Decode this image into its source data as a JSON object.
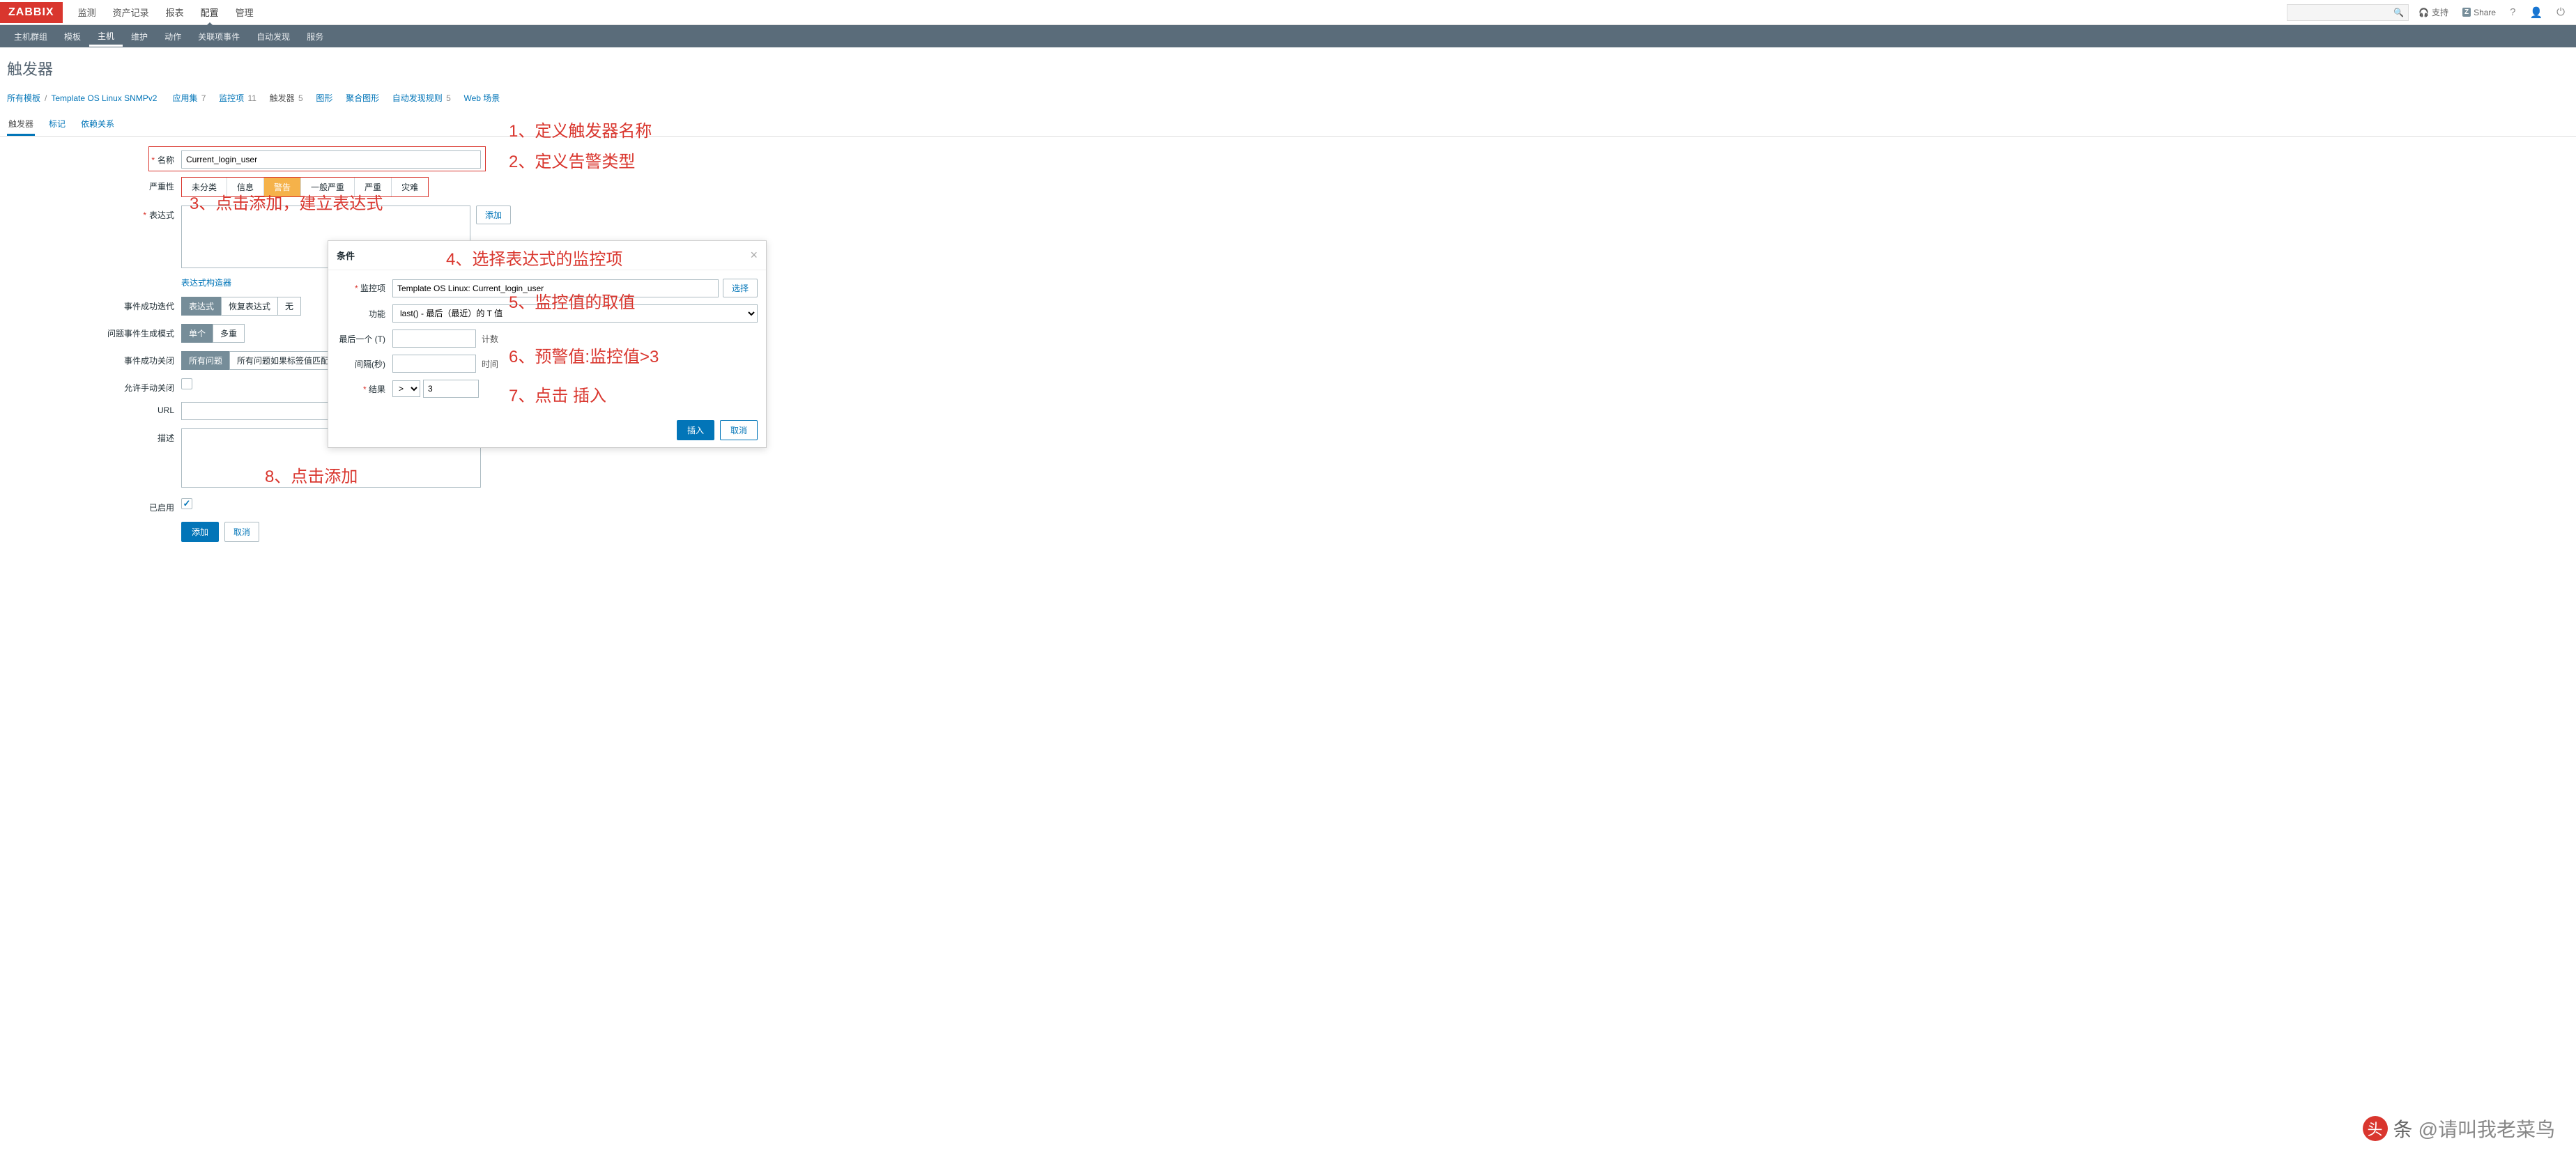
{
  "logo": "ZABBIX",
  "top_menu": [
    "监测",
    "资产记录",
    "报表",
    "配置",
    "管理"
  ],
  "top_menu_active": 3,
  "top_right": {
    "support": "支持",
    "share": "Share",
    "help": "?"
  },
  "sub_nav": [
    "主机群组",
    "模板",
    "主机",
    "维护",
    "动作",
    "关联项事件",
    "自动发现",
    "服务"
  ],
  "sub_nav_active": 2,
  "page_title": "触发器",
  "breadcrumb": {
    "all_templates": "所有模板",
    "template_name": "Template OS Linux SNMPv2",
    "items": [
      {
        "label": "应用集",
        "count": "7"
      },
      {
        "label": "监控项",
        "count": "11"
      },
      {
        "label": "触发器",
        "count": "5",
        "active": true
      },
      {
        "label": "图形",
        "count": ""
      },
      {
        "label": "聚合图形",
        "count": ""
      },
      {
        "label": "自动发现规则",
        "count": "5"
      },
      {
        "label": "Web 场景",
        "count": ""
      }
    ]
  },
  "form_tabs": [
    "触发器",
    "标记",
    "依赖关系"
  ],
  "form_tabs_active": 0,
  "form": {
    "name_label": "名称",
    "name_value": "Current_login_user",
    "severity_label": "严重性",
    "severity_options": [
      "未分类",
      "信息",
      "警告",
      "一般严重",
      "严重",
      "灾难"
    ],
    "severity_selected": 2,
    "expression_label": "表达式",
    "add_btn": "添加",
    "constructor_link": "表达式构造器",
    "event_iteration_label": "事件成功迭代",
    "event_iteration_options": [
      "表达式",
      "恢复表达式",
      "无"
    ],
    "event_gen_label": "问题事件生成模式",
    "event_gen_options": [
      "单个",
      "多重"
    ],
    "event_close_label": "事件成功关闭",
    "event_close_options": [
      "所有问题",
      "所有问题如果标签值匹配"
    ],
    "manual_close_label": "允许手动关闭",
    "url_label": "URL",
    "desc_label": "描述",
    "enabled_label": "已启用",
    "submit_add": "添加",
    "submit_cancel": "取消"
  },
  "modal": {
    "title": "条件",
    "item_label": "监控项",
    "item_value": "Template OS Linux: Current_login_user",
    "select_btn": "选择",
    "func_label": "功能",
    "func_value": "last() - 最后（最近）的 T 值",
    "last_label": "最后一个 (T)",
    "last_suffix": "计数",
    "interval_label": "间隔(秒)",
    "interval_suffix": "时间",
    "result_label": "结果",
    "result_op": ">",
    "result_value": "3",
    "insert_btn": "插入",
    "cancel_btn": "取消"
  },
  "annotations": {
    "a1": "1、定义触发器名称",
    "a2": "2、定义告警类型",
    "a3": "3、点击添加，建立表达式",
    "a4": "4、选择表达式的监控项",
    "a5": "5、监控值的取值",
    "a6": "6、预警值:监控值>3",
    "a7": "7、点击 插入",
    "a8": "8、点击添加"
  },
  "watermark": "头条 @请叫我老菜鸟"
}
